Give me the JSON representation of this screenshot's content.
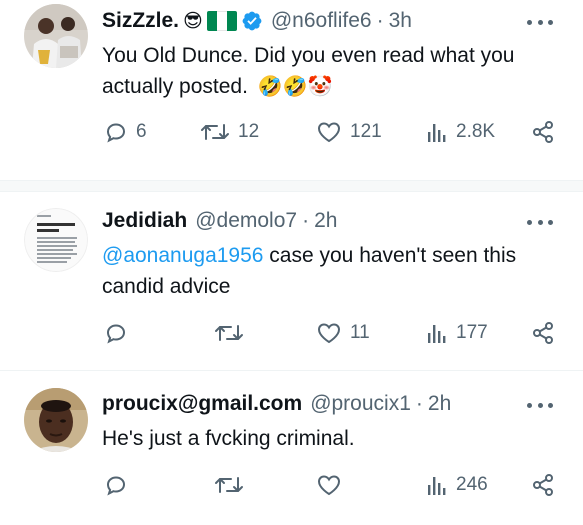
{
  "tweets": [
    {
      "name": "SizZzle.",
      "name_emoji": "😎",
      "verified": true,
      "handle": "@n6oflife6",
      "separator": "·",
      "time": "3h",
      "text": "You Old Dunce. Did you even read what you actually posted.",
      "text_emojis": "🤣🤣🤡",
      "replies": "6",
      "retweets": "12",
      "likes": "121",
      "views": "2.8K"
    },
    {
      "name": "Jedidiah",
      "handle": "@demolo7",
      "separator": "·",
      "time": "2h",
      "mention": "@aonanuga1956",
      "text": " case you haven't seen this candid advice",
      "thumb_lines": [
        "I'm actually a really shy",
        "person."
      ],
      "replies": "",
      "retweets": "",
      "likes": "11",
      "views": "177"
    },
    {
      "name": "proucix@gmail.com",
      "handle": "@proucix1",
      "separator": "·",
      "time": "2h",
      "text": "He's just a fvcking criminal.",
      "replies": "",
      "retweets": "",
      "likes": "",
      "views": "246"
    }
  ],
  "colors": {
    "text": "#0f1419",
    "muted": "#536471",
    "link": "#1d9bf0",
    "verified": "#1d9bf0",
    "flag_green": "#008751",
    "flag_white": "#ffffff",
    "divider": "#eff3f4"
  },
  "icons": [
    "reply-icon",
    "retweet-icon",
    "like-icon",
    "views-icon",
    "share-icon",
    "more-icon",
    "verified-badge-icon"
  ]
}
